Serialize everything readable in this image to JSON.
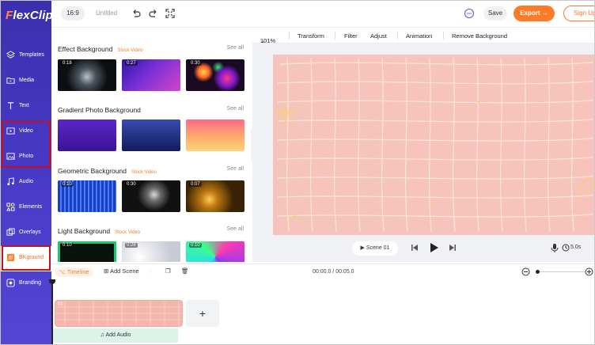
{
  "app": {
    "logo_text": "lexClip",
    "logo_f": "F"
  },
  "topbar": {
    "aspect_ratio": "16:9",
    "project_title": "Untitled",
    "save_label": "Save",
    "export_label": "Export →",
    "signup_label": "Sign Up"
  },
  "sidebar": {
    "items": [
      {
        "label": "Templates",
        "icon": "layers-icon"
      },
      {
        "label": "Media",
        "icon": "folder-icon"
      },
      {
        "label": "Text",
        "icon": "text-icon"
      },
      {
        "label": "Video",
        "icon": "video-icon"
      },
      {
        "label": "Photo",
        "icon": "image-icon"
      },
      {
        "label": "Audio",
        "icon": "music-icon"
      },
      {
        "label": "Elements",
        "icon": "elements-icon"
      },
      {
        "label": "Overlays",
        "icon": "overlays-icon"
      },
      {
        "label": "BKground",
        "icon": "background-icon",
        "active": true
      },
      {
        "label": "Branding",
        "icon": "branding-icon"
      }
    ]
  },
  "panel": {
    "sections": [
      {
        "title": "Effect Background",
        "tag": "Stock Video",
        "see_all": "See all",
        "durations": [
          "0:18",
          "0:27",
          "0:30"
        ]
      },
      {
        "title": "Gradient Photo Background",
        "tag": "",
        "see_all": "See all",
        "durations": [
          "",
          "",
          ""
        ]
      },
      {
        "title": "Geometric Background",
        "tag": "Stock Video",
        "see_all": "See all",
        "durations": [
          "0:10",
          "0:30",
          "0:07"
        ]
      },
      {
        "title": "Light Background",
        "tag": "Stock Video",
        "see_all": "See all",
        "durations": [
          "0:10",
          "0:28",
          "0:10"
        ]
      }
    ]
  },
  "editor_toolbar": {
    "zoom": "101%",
    "transform": "Transform",
    "filter": "Filter",
    "adjust": "Adjust",
    "animation": "Animation",
    "remove_bg": "Remove Background"
  },
  "player": {
    "scene_label": "Scene 01",
    "duration": "5.0s"
  },
  "timeline": {
    "timeline_label": "Timeline",
    "add_scene": "Add Scene",
    "time": "00:00.0 / 00:05.0",
    "clip_number": "01",
    "add_audio": "Add Audio"
  },
  "colors": {
    "accent": "#ff7a26",
    "sidebar": "#4336b8",
    "canvas_bg": "#f6c4ba",
    "highlight": "#c8101c"
  }
}
